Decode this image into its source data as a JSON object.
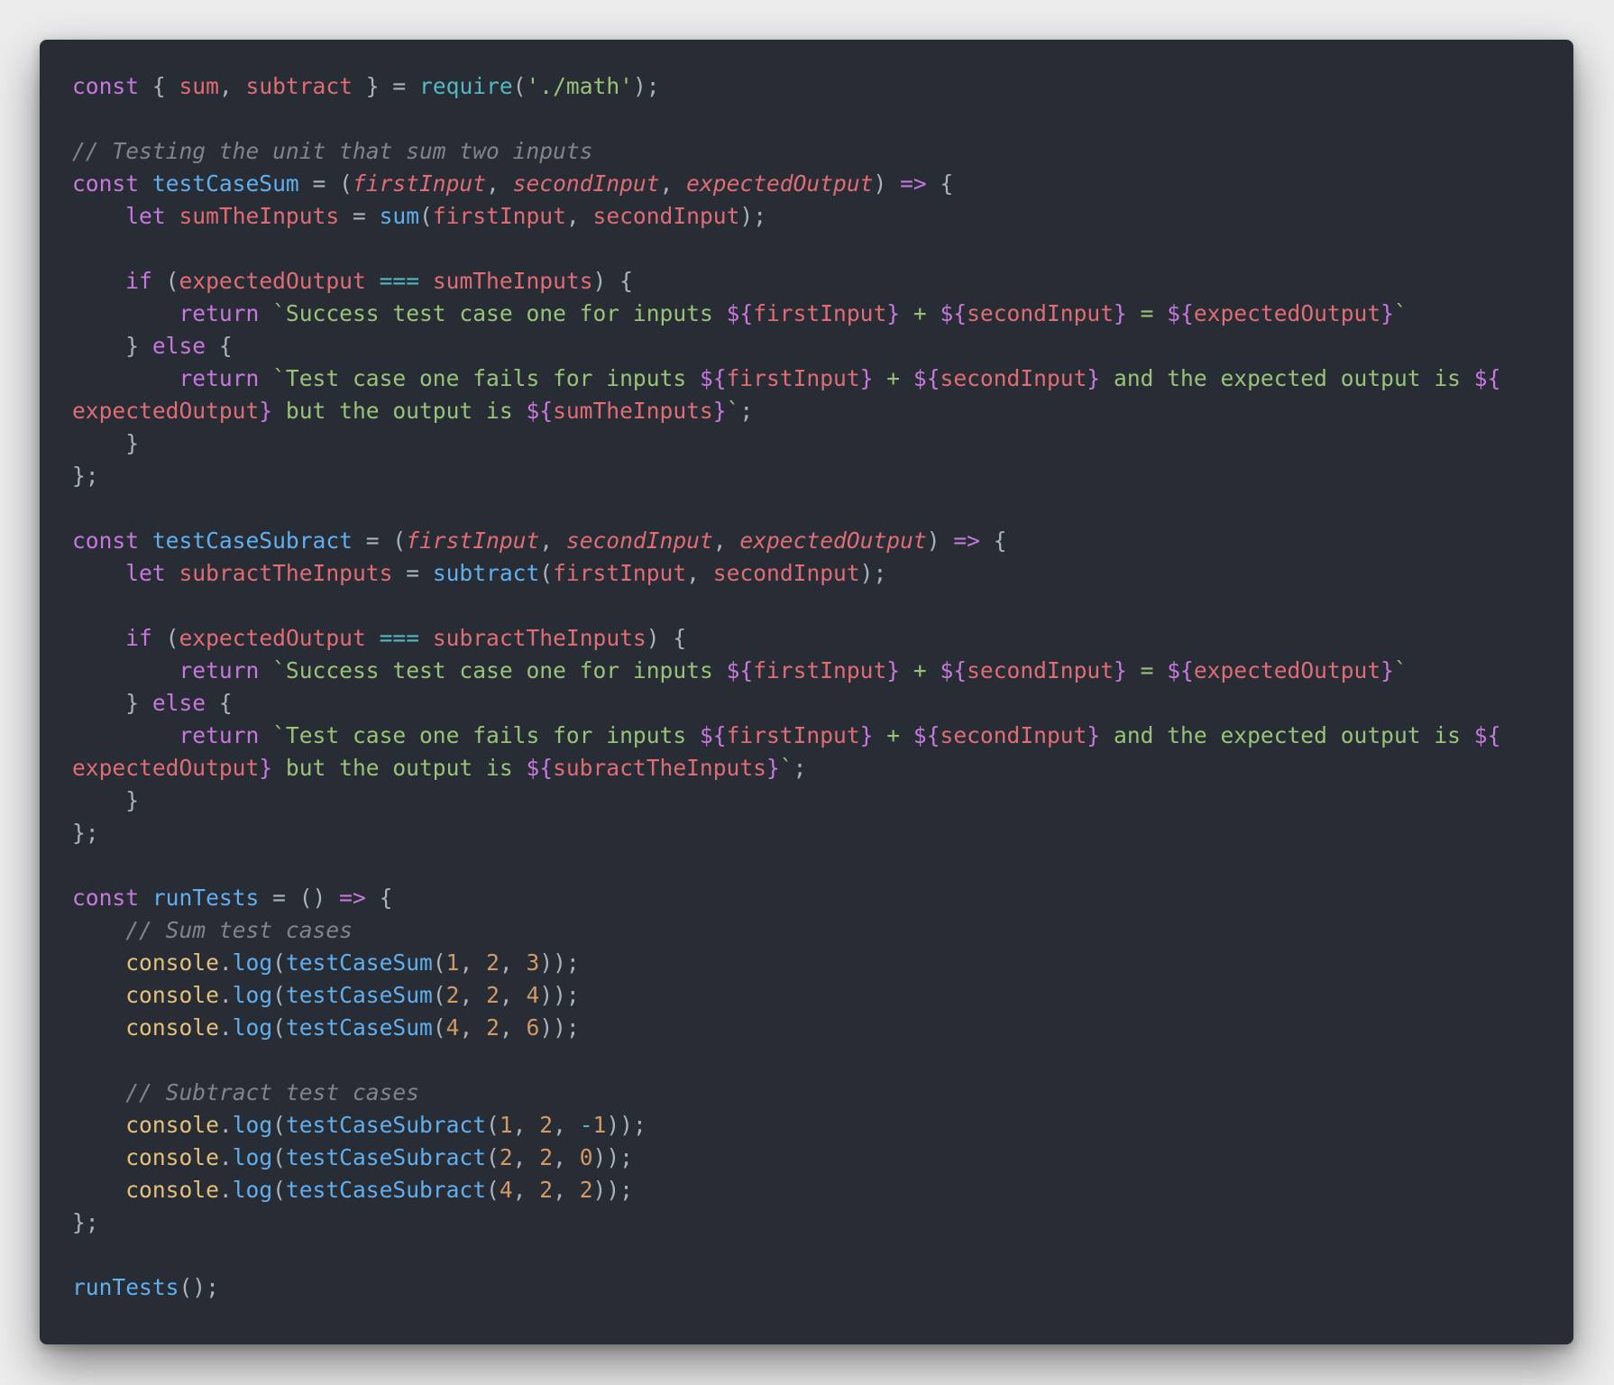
{
  "colors": {
    "page_background": "#ececec",
    "editor_background": "#282c34",
    "default": "#abb2bf",
    "keyword": "#c678dd",
    "variable": "#e06c75",
    "function": "#61afef",
    "string": "#98c379",
    "comment": "#7f848e",
    "number": "#d19a66",
    "object": "#e5c07b",
    "operator": "#56b6c2"
  },
  "code": {
    "language": "javascript",
    "lines": [
      [
        [
          "kw",
          "const"
        ],
        [
          "punc",
          " { "
        ],
        [
          "var",
          "sum"
        ],
        [
          "punc",
          ", "
        ],
        [
          "var",
          "subtract"
        ],
        [
          "punc",
          " } = "
        ],
        [
          "builtin",
          "require"
        ],
        [
          "punc",
          "("
        ],
        [
          "str",
          "'./math'"
        ],
        [
          "punc",
          ");"
        ]
      ],
      [],
      [
        [
          "cmt",
          "// Testing the unit that sum two inputs"
        ]
      ],
      [
        [
          "kw",
          "const "
        ],
        [
          "fn",
          "testCaseSum"
        ],
        [
          "punc",
          " = ("
        ],
        [
          "param",
          "firstInput"
        ],
        [
          "punc",
          ", "
        ],
        [
          "param",
          "secondInput"
        ],
        [
          "punc",
          ", "
        ],
        [
          "param",
          "expectedOutput"
        ],
        [
          "punc",
          ") "
        ],
        [
          "arrow",
          "=>"
        ],
        [
          "punc",
          " {"
        ]
      ],
      [
        [
          "punc",
          "    "
        ],
        [
          "kw",
          "let "
        ],
        [
          "var",
          "sumTheInputs"
        ],
        [
          "punc",
          " = "
        ],
        [
          "fn",
          "sum"
        ],
        [
          "punc",
          "("
        ],
        [
          "var",
          "firstInput"
        ],
        [
          "punc",
          ", "
        ],
        [
          "var",
          "secondInput"
        ],
        [
          "punc",
          ");"
        ]
      ],
      [],
      [
        [
          "punc",
          "    "
        ],
        [
          "kw",
          "if"
        ],
        [
          "punc",
          " ("
        ],
        [
          "var",
          "expectedOutput"
        ],
        [
          "punc",
          " "
        ],
        [
          "op",
          "==="
        ],
        [
          "punc",
          " "
        ],
        [
          "var",
          "sumTheInputs"
        ],
        [
          "punc",
          ") {"
        ]
      ],
      [
        [
          "punc",
          "        "
        ],
        [
          "kw",
          "return "
        ],
        [
          "str",
          "`Success test case one for inputs "
        ],
        [
          "tpl",
          "${"
        ],
        [
          "var",
          "firstInput"
        ],
        [
          "tpl",
          "}"
        ],
        [
          "str",
          " + "
        ],
        [
          "tpl",
          "${"
        ],
        [
          "var",
          "secondInput"
        ],
        [
          "tpl",
          "}"
        ],
        [
          "str",
          " = "
        ],
        [
          "tpl",
          "${"
        ],
        [
          "var",
          "expectedOutput"
        ],
        [
          "tpl",
          "}"
        ],
        [
          "str",
          "`"
        ]
      ],
      [
        [
          "punc",
          "    } "
        ],
        [
          "kw",
          "else"
        ],
        [
          "punc",
          " {"
        ]
      ],
      [
        [
          "punc",
          "        "
        ],
        [
          "kw",
          "return "
        ],
        [
          "str",
          "`Test case one fails for inputs "
        ],
        [
          "tpl",
          "${"
        ],
        [
          "var",
          "firstInput"
        ],
        [
          "tpl",
          "}"
        ],
        [
          "str",
          " + "
        ],
        [
          "tpl",
          "${"
        ],
        [
          "var",
          "secondInput"
        ],
        [
          "tpl",
          "}"
        ],
        [
          "str",
          " and the expected output is "
        ],
        [
          "tpl",
          "${"
        ]
      ],
      [
        [
          "var",
          "expectedOutput"
        ],
        [
          "tpl",
          "}"
        ],
        [
          "str",
          " but the output is "
        ],
        [
          "tpl",
          "${"
        ],
        [
          "var",
          "sumTheInputs"
        ],
        [
          "tpl",
          "}"
        ],
        [
          "str",
          "`"
        ],
        [
          "punc",
          ";"
        ]
      ],
      [
        [
          "punc",
          "    }"
        ]
      ],
      [
        [
          "punc",
          "};"
        ]
      ],
      [],
      [
        [
          "kw",
          "const "
        ],
        [
          "fn",
          "testCaseSubract"
        ],
        [
          "punc",
          " = ("
        ],
        [
          "param",
          "firstInput"
        ],
        [
          "punc",
          ", "
        ],
        [
          "param",
          "secondInput"
        ],
        [
          "punc",
          ", "
        ],
        [
          "param",
          "expectedOutput"
        ],
        [
          "punc",
          ") "
        ],
        [
          "arrow",
          "=>"
        ],
        [
          "punc",
          " {"
        ]
      ],
      [
        [
          "punc",
          "    "
        ],
        [
          "kw",
          "let "
        ],
        [
          "var",
          "subractTheInputs"
        ],
        [
          "punc",
          " = "
        ],
        [
          "fn",
          "subtract"
        ],
        [
          "punc",
          "("
        ],
        [
          "var",
          "firstInput"
        ],
        [
          "punc",
          ", "
        ],
        [
          "var",
          "secondInput"
        ],
        [
          "punc",
          ");"
        ]
      ],
      [],
      [
        [
          "punc",
          "    "
        ],
        [
          "kw",
          "if"
        ],
        [
          "punc",
          " ("
        ],
        [
          "var",
          "expectedOutput"
        ],
        [
          "punc",
          " "
        ],
        [
          "op",
          "==="
        ],
        [
          "punc",
          " "
        ],
        [
          "var",
          "subractTheInputs"
        ],
        [
          "punc",
          ") {"
        ]
      ],
      [
        [
          "punc",
          "        "
        ],
        [
          "kw",
          "return "
        ],
        [
          "str",
          "`Success test case one for inputs "
        ],
        [
          "tpl",
          "${"
        ],
        [
          "var",
          "firstInput"
        ],
        [
          "tpl",
          "}"
        ],
        [
          "str",
          " + "
        ],
        [
          "tpl",
          "${"
        ],
        [
          "var",
          "secondInput"
        ],
        [
          "tpl",
          "}"
        ],
        [
          "str",
          " = "
        ],
        [
          "tpl",
          "${"
        ],
        [
          "var",
          "expectedOutput"
        ],
        [
          "tpl",
          "}"
        ],
        [
          "str",
          "`"
        ]
      ],
      [
        [
          "punc",
          "    } "
        ],
        [
          "kw",
          "else"
        ],
        [
          "punc",
          " {"
        ]
      ],
      [
        [
          "punc",
          "        "
        ],
        [
          "kw",
          "return "
        ],
        [
          "str",
          "`Test case one fails for inputs "
        ],
        [
          "tpl",
          "${"
        ],
        [
          "var",
          "firstInput"
        ],
        [
          "tpl",
          "}"
        ],
        [
          "str",
          " + "
        ],
        [
          "tpl",
          "${"
        ],
        [
          "var",
          "secondInput"
        ],
        [
          "tpl",
          "}"
        ],
        [
          "str",
          " and the expected output is "
        ],
        [
          "tpl",
          "${"
        ]
      ],
      [
        [
          "var",
          "expectedOutput"
        ],
        [
          "tpl",
          "}"
        ],
        [
          "str",
          " but the output is "
        ],
        [
          "tpl",
          "${"
        ],
        [
          "var",
          "subractTheInputs"
        ],
        [
          "tpl",
          "}"
        ],
        [
          "str",
          "`"
        ],
        [
          "punc",
          ";"
        ]
      ],
      [
        [
          "punc",
          "    }"
        ]
      ],
      [
        [
          "punc",
          "};"
        ]
      ],
      [],
      [
        [
          "kw",
          "const "
        ],
        [
          "fn",
          "runTests"
        ],
        [
          "punc",
          " = () "
        ],
        [
          "arrow",
          "=>"
        ],
        [
          "punc",
          " {"
        ]
      ],
      [
        [
          "punc",
          "    "
        ],
        [
          "cmt",
          "// Sum test cases"
        ]
      ],
      [
        [
          "punc",
          "    "
        ],
        [
          "obj",
          "console"
        ],
        [
          "punc",
          "."
        ],
        [
          "fn",
          "log"
        ],
        [
          "punc",
          "("
        ],
        [
          "fn",
          "testCaseSum"
        ],
        [
          "punc",
          "("
        ],
        [
          "num",
          "1"
        ],
        [
          "punc",
          ", "
        ],
        [
          "num",
          "2"
        ],
        [
          "punc",
          ", "
        ],
        [
          "num",
          "3"
        ],
        [
          "punc",
          "));"
        ]
      ],
      [
        [
          "punc",
          "    "
        ],
        [
          "obj",
          "console"
        ],
        [
          "punc",
          "."
        ],
        [
          "fn",
          "log"
        ],
        [
          "punc",
          "("
        ],
        [
          "fn",
          "testCaseSum"
        ],
        [
          "punc",
          "("
        ],
        [
          "num",
          "2"
        ],
        [
          "punc",
          ", "
        ],
        [
          "num",
          "2"
        ],
        [
          "punc",
          ", "
        ],
        [
          "num",
          "4"
        ],
        [
          "punc",
          "));"
        ]
      ],
      [
        [
          "punc",
          "    "
        ],
        [
          "obj",
          "console"
        ],
        [
          "punc",
          "."
        ],
        [
          "fn",
          "log"
        ],
        [
          "punc",
          "("
        ],
        [
          "fn",
          "testCaseSum"
        ],
        [
          "punc",
          "("
        ],
        [
          "num",
          "4"
        ],
        [
          "punc",
          ", "
        ],
        [
          "num",
          "2"
        ],
        [
          "punc",
          ", "
        ],
        [
          "num",
          "6"
        ],
        [
          "punc",
          "));"
        ]
      ],
      [],
      [
        [
          "punc",
          "    "
        ],
        [
          "cmt",
          "// Subtract test cases"
        ]
      ],
      [
        [
          "punc",
          "    "
        ],
        [
          "obj",
          "console"
        ],
        [
          "punc",
          "."
        ],
        [
          "fn",
          "log"
        ],
        [
          "punc",
          "("
        ],
        [
          "fn",
          "testCaseSubract"
        ],
        [
          "punc",
          "("
        ],
        [
          "num",
          "1"
        ],
        [
          "punc",
          ", "
        ],
        [
          "num",
          "2"
        ],
        [
          "punc",
          ", "
        ],
        [
          "op",
          "-"
        ],
        [
          "num",
          "1"
        ],
        [
          "punc",
          "));"
        ]
      ],
      [
        [
          "punc",
          "    "
        ],
        [
          "obj",
          "console"
        ],
        [
          "punc",
          "."
        ],
        [
          "fn",
          "log"
        ],
        [
          "punc",
          "("
        ],
        [
          "fn",
          "testCaseSubract"
        ],
        [
          "punc",
          "("
        ],
        [
          "num",
          "2"
        ],
        [
          "punc",
          ", "
        ],
        [
          "num",
          "2"
        ],
        [
          "punc",
          ", "
        ],
        [
          "num",
          "0"
        ],
        [
          "punc",
          "));"
        ]
      ],
      [
        [
          "punc",
          "    "
        ],
        [
          "obj",
          "console"
        ],
        [
          "punc",
          "."
        ],
        [
          "fn",
          "log"
        ],
        [
          "punc",
          "("
        ],
        [
          "fn",
          "testCaseSubract"
        ],
        [
          "punc",
          "("
        ],
        [
          "num",
          "4"
        ],
        [
          "punc",
          ", "
        ],
        [
          "num",
          "2"
        ],
        [
          "punc",
          ", "
        ],
        [
          "num",
          "2"
        ],
        [
          "punc",
          "));"
        ]
      ],
      [
        [
          "punc",
          "};"
        ]
      ],
      [],
      [
        [
          "fn",
          "runTests"
        ],
        [
          "punc",
          "();"
        ]
      ]
    ]
  }
}
